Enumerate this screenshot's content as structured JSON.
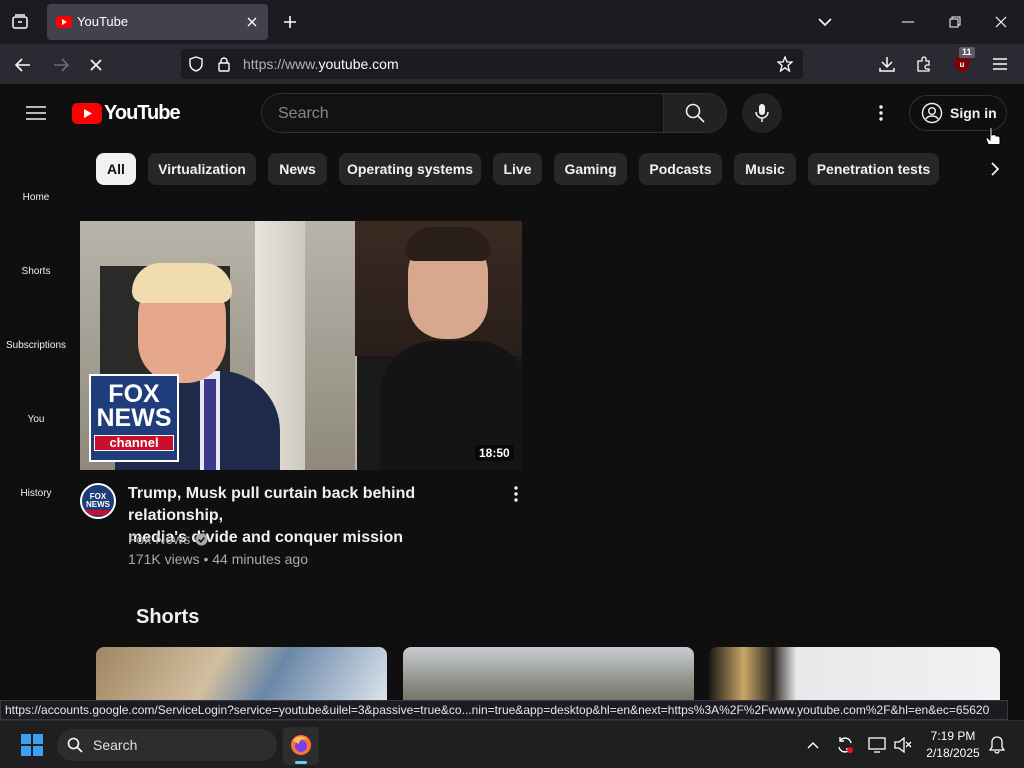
{
  "browser": {
    "tab_title": "YouTube",
    "url_prefix": "https://www.",
    "url_domain": "youtube.com",
    "extension_badge": "11"
  },
  "youtube": {
    "logo_text": "YouTube",
    "search_placeholder": "Search",
    "sign_in_label": "Sign in",
    "chips": [
      "All",
      "Virtualization",
      "News",
      "Operating systems",
      "Live",
      "Gaming",
      "Podcasts",
      "Music",
      "Penetration tests"
    ],
    "guide": [
      "Home",
      "Shorts",
      "Subscriptions",
      "You",
      "History"
    ],
    "video": {
      "duration": "18:50",
      "title_line1": "Trump, Musk pull curtain back behind relationship,",
      "title_line2": "media's divide and conquer mission",
      "channel": "Fox News",
      "meta": "171K views • 44 minutes ago",
      "logo_line1": "FOX",
      "logo_line2": "NEWS",
      "logo_line3": "channel"
    },
    "shorts_heading": "Shorts"
  },
  "status_url": "https://accounts.google.com/ServiceLogin?service=youtube&uilel=3&passive=true&co...nin=true&app=desktop&hl=en&next=https%3A%2F%2Fwww.youtube.com%2F&hl=en&ec=65620",
  "taskbar": {
    "search_label": "Search",
    "time": "7:19 PM",
    "date": "2/18/2025"
  },
  "colors": {
    "yt_red": "#ff0000",
    "fox_blue": "#1f3d7a",
    "accent": "#3ea6ff"
  }
}
